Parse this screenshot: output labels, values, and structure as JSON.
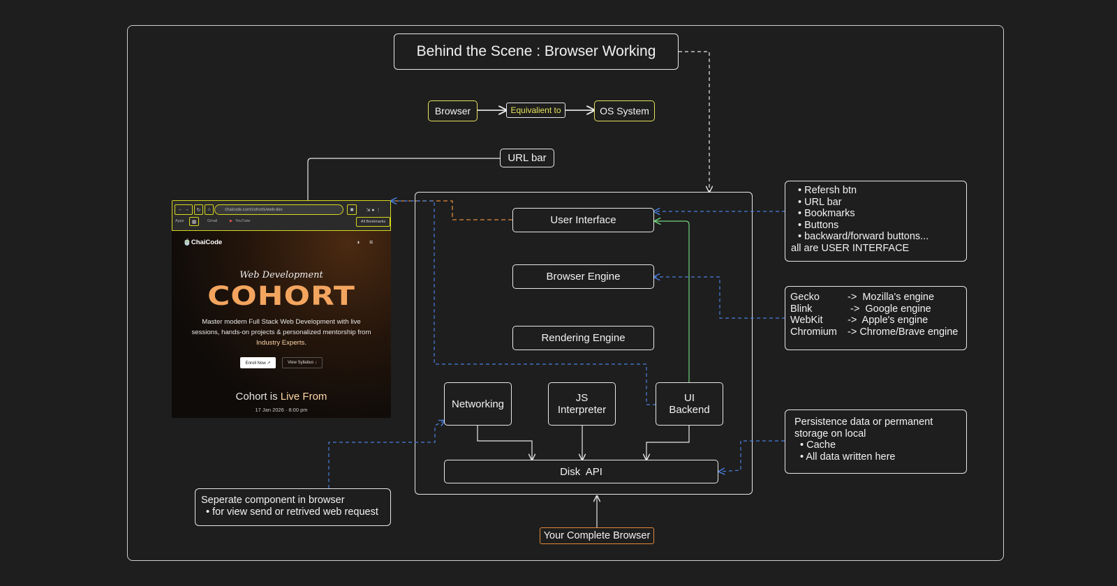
{
  "title": "Behind the Scene : Browser Working",
  "equivalence": {
    "browser": "Browser",
    "link": "Equivalient to",
    "os": "OS System"
  },
  "url_bar_label": "URL bar",
  "components": {
    "user_interface": "User Interface",
    "browser_engine": "Browser Engine",
    "rendering_engine": "Rendering Engine",
    "networking": "Networking",
    "js_interpreter": [
      "JS",
      "Interpreter"
    ],
    "ui_backend": [
      "UI",
      "Backend"
    ],
    "disk_api": "Disk  API"
  },
  "ui_note": {
    "items": [
      "Refersh btn",
      "URL bar",
      "Bookmarks",
      "Buttons",
      "backward/forward buttons..."
    ],
    "footer": "all are USER INTERFACE"
  },
  "engines_note": [
    {
      "name": "Gecko",
      "engine": "->  Mozilla's engine"
    },
    {
      "name": "Blink",
      "engine": " ->  Google engine"
    },
    {
      "name": "WebKit",
      "engine": "->  Apple's engine"
    },
    {
      "name": "Chromium",
      "engine": "-> Chrome/Brave engine"
    }
  ],
  "persistence_note": {
    "line1": "Persistence data or permanent",
    "line2": "storage on local",
    "items": [
      "Cache",
      "All data written here"
    ]
  },
  "networking_note": {
    "line1": "Seperate component in browser",
    "item": "for view send or retrived web request"
  },
  "complete_browser": "Your Complete Browser",
  "screenshot": {
    "url": "chaicode.com/cohorts/web-dev",
    "bookmarks": [
      "Apps",
      "Gmail",
      "YouTube",
      "All Bookmarks"
    ],
    "logo": "ChaiCode",
    "script_title": "Web Development",
    "headline": "COHORT",
    "desc_1": "Master modern Full Stack Web Development with live",
    "desc_2": "sessions, hands-on projects & personalized mentorship from",
    "desc_3": "Industry Experts.",
    "enroll": "Enroll Now ↗",
    "syllabus": "View Syllabus ↓",
    "live_prefix": "Cohort is ",
    "live_highlight": "Live From",
    "date": "17 Jan 2026 · 8:00 pm"
  },
  "colors": {
    "background": "#1e1e1e",
    "outline": "#e8e8e8",
    "yellow": "#e6e35e",
    "blue_dashed": "#4a7fe0",
    "orange": "#e08a3a",
    "green": "#6fd37a"
  }
}
